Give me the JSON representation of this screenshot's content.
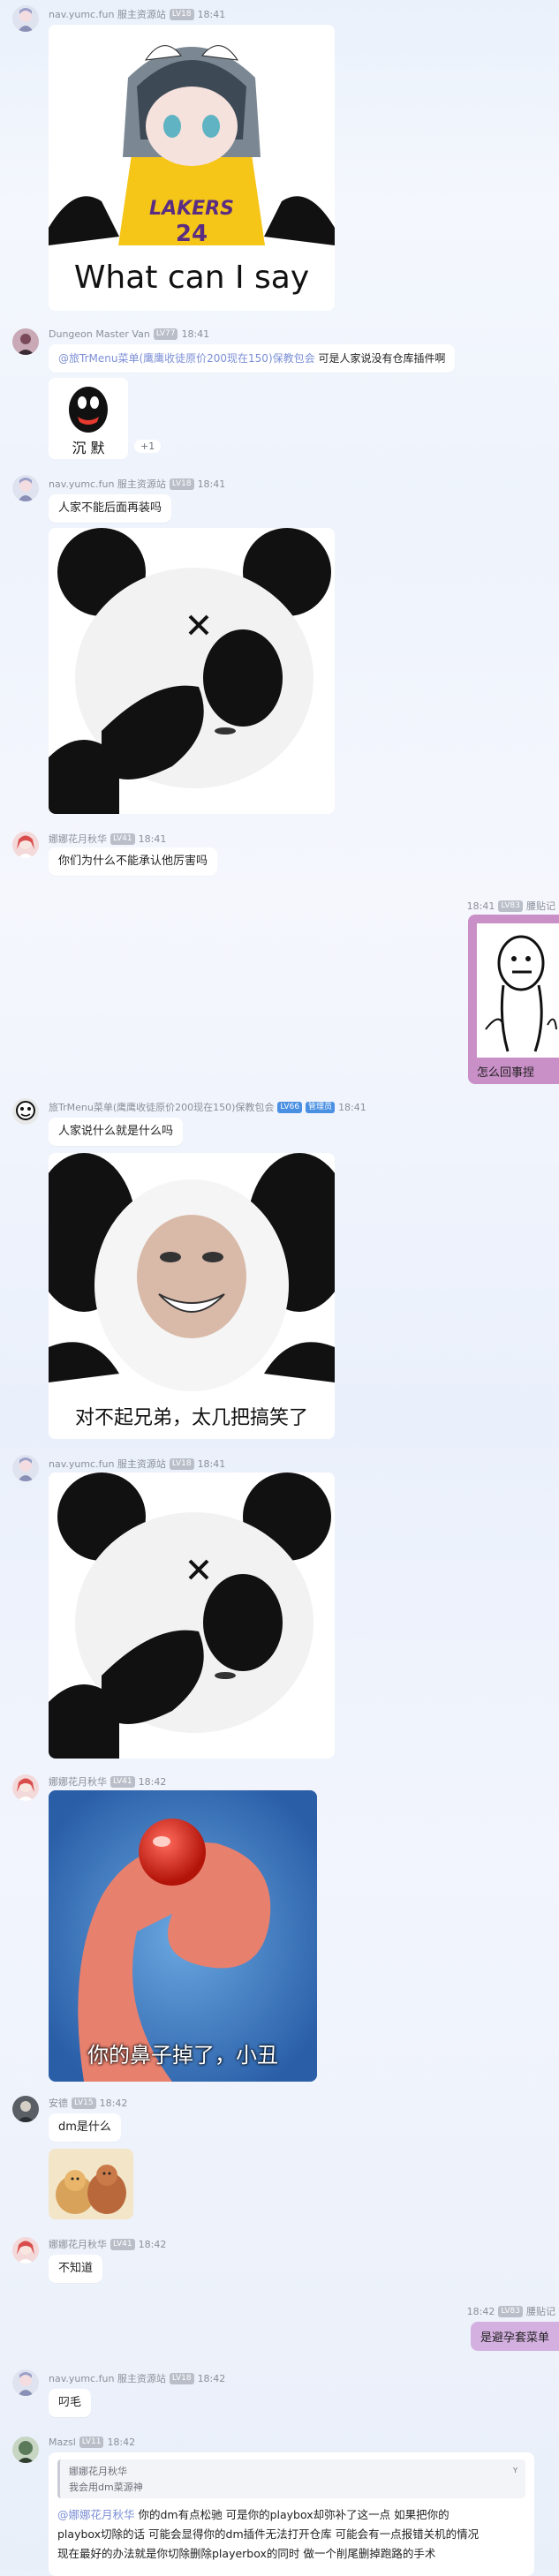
{
  "colors": {
    "accent": "#d4b0e0",
    "mention": "#7c8fd6",
    "staff_badge": "#4a90e2"
  },
  "messages": [
    {
      "name": "nav.yumc.fun 服主资源站",
      "level": "LV18",
      "time": "18:41",
      "image_caption": "What can I say",
      "image_text": "LAKERS 24"
    },
    {
      "name": "Dungeon Master Van",
      "level": "LV77",
      "time": "18:41",
      "mention": "@旅TrMenu菜单(鹰鹰收徒原价200现在150)保教包会",
      "text": " 可是人家说没有仓库插件啊",
      "sticker_caption": "沉 默",
      "reaction": "+1"
    },
    {
      "name": "nav.yumc.fun 服主资源站",
      "level": "LV18",
      "time": "18:41",
      "text": "人家不能后面再装吗"
    },
    {
      "name": "娜娜花月秋华",
      "level": "LV41",
      "time": "18:41",
      "text": "你们为什么不能承认他厉害吗"
    },
    {
      "self": true,
      "name": "腰贴记",
      "level": "LV83",
      "time": "18:41",
      "image_caption": "怎么回事捏"
    },
    {
      "name": "旅TrMenu菜单(鹰鹰收徒原价200现在150)保教包会",
      "level": "LV66",
      "badge": "管理员",
      "time": "18:41",
      "text": "人家说什么就是什么吗",
      "image_caption": "对不起兄弟，太几把搞笑了"
    },
    {
      "name": "nav.yumc.fun 服主资源站",
      "level": "LV18",
      "time": "18:41"
    },
    {
      "name": "娜娜花月秋华",
      "level": "LV41",
      "time": "18:42",
      "image_caption": "你的鼻子掉了，小丑"
    },
    {
      "name": "安德",
      "level": "LV15",
      "time": "18:42",
      "text": "dm是什么"
    },
    {
      "name": "娜娜花月秋华",
      "level": "LV41",
      "time": "18:42",
      "text": "不知道"
    },
    {
      "self": true,
      "name": "腰贴记",
      "level": "LV83",
      "time": "18:42",
      "text": "是避孕套菜单"
    },
    {
      "name": "nav.yumc.fun 服主资源站",
      "level": "LV18",
      "time": "18:42",
      "text": "叼毛"
    },
    {
      "name": "Mazsl",
      "level": "LV11",
      "time": "18:42",
      "quote_name": "娜娜花月秋华",
      "quote_text": "我会用dm菜源神",
      "mention": "@娜娜花月秋华",
      "text": " 你的dm有点松驰 可是你的playbox却弥补了这一点 如果把你的",
      "text2": "playbox切除的话 可能会显得你的dm插件无法打开仓库 可能会有一点报错关机的情况",
      "text3": "现在最好的办法就是你切除删除playerbox的同时 做一个削尾删掉跑路的手术"
    }
  ]
}
